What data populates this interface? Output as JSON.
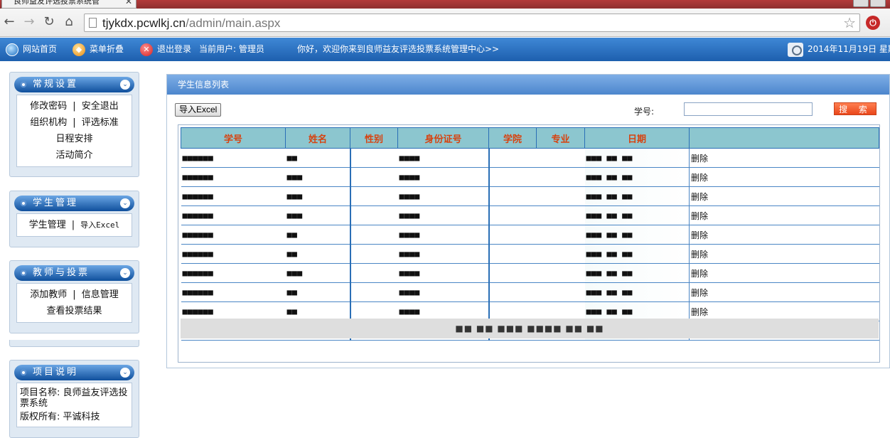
{
  "browser": {
    "tab_title": "良师益友评选投票系统管",
    "url_host": "tjykdx.pcwlkj.cn",
    "url_path": "/admin/main.aspx"
  },
  "topbar": {
    "home": "网站首页",
    "fold_menu": "菜单折叠",
    "logout": "退出登录",
    "current_user": "当前用户: 管理员",
    "welcome": "你好，欢迎你来到良师益友评选投票系统管理中心>>",
    "date": "2014年11月19日 星期"
  },
  "sidebar": {
    "general": {
      "title": "常规设置",
      "change_password": "修改密码",
      "safe_exit": "安全退出",
      "org": "组织机构",
      "criteria": "评选标准",
      "schedule": "日程安排",
      "about": "活动简介"
    },
    "students": {
      "title": "学生管理",
      "manage": "学生管理",
      "import_excel": "导入Excel"
    },
    "teachers": {
      "title": "教师与投票",
      "add_teacher": "添加教师",
      "info_manage": "信息管理",
      "view_results": "查看投票结果"
    },
    "project": {
      "title": "项目说明",
      "name_label": "项目名称: 良师益友评选投票系统",
      "copyright_label": "版权所有:  平诚科技"
    }
  },
  "main": {
    "title": "学生信息列表",
    "import_button": "导入Excel",
    "student_id_label": "学号:",
    "student_id_value": "",
    "search_button": "搜 索",
    "columns": [
      "学号",
      "姓名",
      "性别",
      "身份证号",
      "学院",
      "专业",
      "日期",
      ""
    ],
    "delete_label": "删除",
    "rows": [
      {
        "id": "■■■■■■",
        "name": "■■",
        "gender": "",
        "idno": "■■■■",
        "college": "",
        "major": "",
        "date": "■■■ ■■ ■■"
      },
      {
        "id": "■■■■■■",
        "name": "■■■",
        "gender": "",
        "idno": "■■■■",
        "college": "",
        "major": "",
        "date": "■■■ ■■ ■■"
      },
      {
        "id": "■■■■■■",
        "name": "■■■",
        "gender": "",
        "idno": "■■■■",
        "college": "",
        "major": "",
        "date": "■■■ ■■ ■■"
      },
      {
        "id": "■■■■■■",
        "name": "■■■",
        "gender": "",
        "idno": "■■■■",
        "college": "",
        "major": "",
        "date": "■■■ ■■ ■■"
      },
      {
        "id": "■■■■■■",
        "name": "■■",
        "gender": "",
        "idno": "■■■■",
        "college": "",
        "major": "",
        "date": "■■■ ■■ ■■"
      },
      {
        "id": "■■■■■■",
        "name": "■■",
        "gender": "",
        "idno": "■■■■",
        "college": "",
        "major": "",
        "date": "■■■ ■■ ■■"
      },
      {
        "id": "■■■■■■",
        "name": "■■■",
        "gender": "",
        "idno": "■■■■",
        "college": "",
        "major": "",
        "date": "■■■ ■■ ■■"
      },
      {
        "id": "■■■■■■",
        "name": "■■",
        "gender": "",
        "idno": "■■■■",
        "college": "",
        "major": "",
        "date": "■■■ ■■ ■■"
      },
      {
        "id": "■■■■■■",
        "name": "■■",
        "gender": "",
        "idno": "■■■■",
        "college": "",
        "major": "",
        "date": "■■■ ■■ ■■"
      },
      {
        "id": "■■■■■■",
        "name": "■■■",
        "gender": "",
        "idno": "■■■■",
        "college": "",
        "major": "",
        "date": "■■■ ■■ ■■"
      }
    ],
    "pager": "■■ ■■ ■■■ ■■■■ ■■ ■■"
  }
}
